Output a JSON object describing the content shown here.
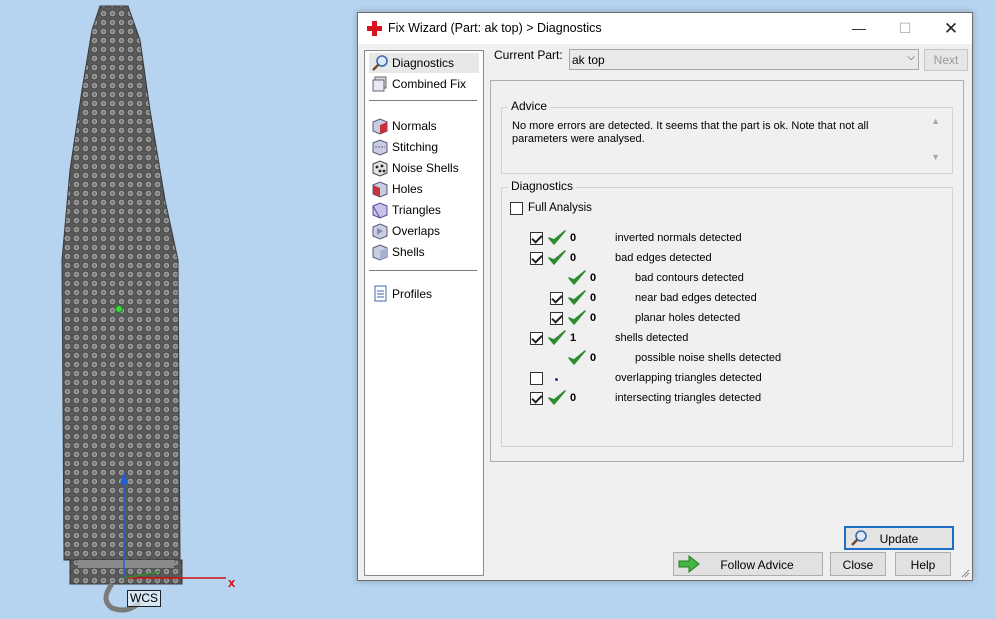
{
  "viewport": {
    "wcs_label": "WCS",
    "axis_x_label": "x"
  },
  "window": {
    "title": "Fix Wizard (Part: ak top) > Diagnostics",
    "controls": {
      "minimize": "—",
      "maximize": "☐",
      "close": "✕"
    }
  },
  "nav": {
    "groups": [
      [
        {
          "label": "Diagnostics",
          "icon": "magnifier-icon",
          "selected": true
        },
        {
          "label": "Combined Fix",
          "icon": "combined-fix-icon"
        }
      ],
      [
        {
          "label": "Normals",
          "icon": "normals-cube-icon"
        },
        {
          "label": "Stitching",
          "icon": "stitching-cube-icon"
        },
        {
          "label": "Noise Shells",
          "icon": "noise-shells-icon"
        },
        {
          "label": "Holes",
          "icon": "holes-cube-icon"
        },
        {
          "label": "Triangles",
          "icon": "triangles-cube-icon"
        },
        {
          "label": "Overlaps",
          "icon": "overlaps-cube-icon"
        },
        {
          "label": "Shells",
          "icon": "shells-cube-icon"
        }
      ],
      [
        {
          "label": "Profiles",
          "icon": "profiles-document-icon"
        }
      ]
    ]
  },
  "current_part": {
    "label": "Current Part:",
    "value": "ak top",
    "next_label": "Next"
  },
  "advice": {
    "title": "Advice",
    "text": "No more errors are detected. It seems that the part is ok. Note that not all parameters were analysed."
  },
  "diagnostics": {
    "title": "Diagnostics",
    "full_analysis_label": "Full Analysis",
    "full_analysis_checked": false,
    "rows": [
      {
        "checked": true,
        "has_checkbox": true,
        "status": "ok",
        "count": "0",
        "label": "inverted normals detected",
        "indent": 0
      },
      {
        "checked": true,
        "has_checkbox": true,
        "status": "ok",
        "count": "0",
        "label": "bad edges detected",
        "indent": 0
      },
      {
        "checked": false,
        "has_checkbox": false,
        "status": "ok",
        "count": "0",
        "label": "bad contours detected",
        "indent": 1
      },
      {
        "checked": true,
        "has_checkbox": true,
        "status": "ok",
        "count": "0",
        "label": "near bad edges detected",
        "indent": 1
      },
      {
        "checked": true,
        "has_checkbox": true,
        "status": "ok",
        "count": "0",
        "label": "planar holes detected",
        "indent": 1
      },
      {
        "checked": true,
        "has_checkbox": true,
        "status": "ok",
        "count": "1",
        "label": "shells detected",
        "indent": 0
      },
      {
        "checked": false,
        "has_checkbox": false,
        "status": "ok",
        "count": "0",
        "label": "possible noise shells detected",
        "indent": 1
      },
      {
        "checked": false,
        "has_checkbox": true,
        "status": "pending",
        "count": "",
        "label": "overlapping triangles detected",
        "indent": 0
      },
      {
        "checked": true,
        "has_checkbox": true,
        "status": "ok",
        "count": "0",
        "label": "intersecting triangles detected",
        "indent": 0
      }
    ],
    "update_label": "Update"
  },
  "footer": {
    "follow_advice_label": "Follow Advice",
    "close_label": "Close",
    "help_label": "Help"
  },
  "colors": {
    "tick_green": "#2e8b2e",
    "accent_blue": "#1e6ec8",
    "viewport_bg": "#b6d3ef"
  }
}
